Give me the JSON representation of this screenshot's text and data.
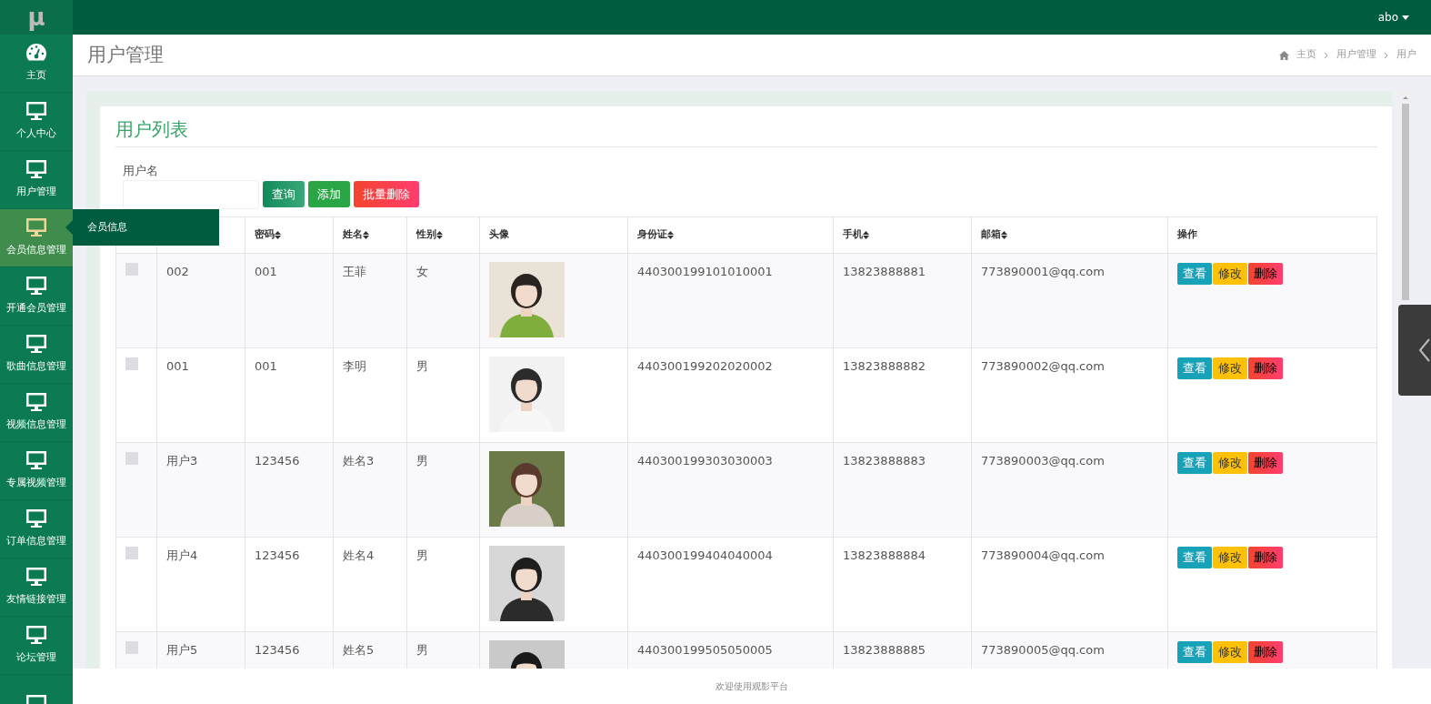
{
  "logo": "μ",
  "topbar": {
    "user": "abo"
  },
  "sidebar": {
    "items": [
      {
        "kind": "dashboard",
        "label": "主页",
        "hovered": false
      },
      {
        "kind": "module",
        "label": "个人中心",
        "hovered": false
      },
      {
        "kind": "module",
        "label": "用户管理",
        "hovered": false
      },
      {
        "kind": "module",
        "label": "会员信息管理",
        "hovered": true,
        "submenu": [
          "会员信息"
        ]
      },
      {
        "kind": "module",
        "label": "开通会员管理",
        "hovered": false
      },
      {
        "kind": "module",
        "label": "歌曲信息管理",
        "hovered": false
      },
      {
        "kind": "module",
        "label": "视频信息管理",
        "hovered": false
      },
      {
        "kind": "module",
        "label": "专属视频管理",
        "hovered": false
      },
      {
        "kind": "module",
        "label": "订单信息管理",
        "hovered": false
      },
      {
        "kind": "module",
        "label": "友情链接管理",
        "hovered": false
      },
      {
        "kind": "module",
        "label": "论坛管理",
        "hovered": false
      },
      {
        "kind": "module",
        "hovered": false
      }
    ]
  },
  "header": {
    "title": "用户管理",
    "breadcrumb": [
      "主页",
      "用户管理",
      "用户"
    ]
  },
  "panel": {
    "title": "用户列表",
    "search": {
      "label": "用户名"
    },
    "buttons": [
      {
        "kind": "search",
        "label": "查询"
      },
      {
        "kind": "add",
        "label": "添加"
      },
      {
        "kind": "delete",
        "label": "批量删除"
      }
    ],
    "table": {
      "columns": [
        {
          "label": "密码",
          "sortable": true
        },
        {
          "label": "姓名",
          "sortable": true
        },
        {
          "label": "性别",
          "sortable": true
        },
        {
          "label": "头像",
          "sortable": false
        },
        {
          "label": "身份证",
          "sortable": true
        },
        {
          "label": "手机",
          "sortable": true
        },
        {
          "label": "邮箱",
          "sortable": true
        },
        {
          "label": "操作",
          "sortable": false
        }
      ],
      "rows": [
        {
          "checked": false,
          "username": "002",
          "password": "001",
          "name": "王菲",
          "gender": "女",
          "id_card": "440300199101010001",
          "phone": "13823888881",
          "email": "773890001@qq.com",
          "actions": [
            {
              "kind": "view",
              "label": "查看"
            },
            {
              "kind": "edit",
              "label": "修改"
            },
            {
              "kind": "delete",
              "label": "删除"
            }
          ]
        },
        {
          "checked": false,
          "username": "001",
          "password": "001",
          "name": "李明",
          "gender": "男",
          "id_card": "440300199202020002",
          "phone": "13823888882",
          "email": "773890002@qq.com",
          "actions": [
            {
              "kind": "view",
              "label": "查看"
            },
            {
              "kind": "edit",
              "label": "修改"
            },
            {
              "kind": "delete",
              "label": "删除"
            }
          ]
        },
        {
          "checked": false,
          "username": "用户3",
          "password": "123456",
          "name": "姓名3",
          "gender": "男",
          "id_card": "440300199303030003",
          "phone": "13823888883",
          "email": "773890003@qq.com",
          "actions": [
            {
              "kind": "view",
              "label": "查看"
            },
            {
              "kind": "edit",
              "label": "修改"
            },
            {
              "kind": "delete",
              "label": "删除"
            }
          ]
        },
        {
          "checked": false,
          "username": "用户4",
          "password": "123456",
          "name": "姓名4",
          "gender": "男",
          "id_card": "440300199404040004",
          "phone": "13823888884",
          "email": "773890004@qq.com",
          "actions": [
            {
              "kind": "view",
              "label": "查看"
            },
            {
              "kind": "edit",
              "label": "修改"
            },
            {
              "kind": "delete",
              "label": "删除"
            }
          ]
        },
        {
          "checked": false,
          "username": "用户5",
          "password": "123456",
          "name": "姓名5",
          "gender": "男",
          "id_card": "440300199505050005",
          "phone": "13823888885",
          "email": "773890005@qq.com",
          "actions": [
            {
              "kind": "view",
              "label": "查看"
            },
            {
              "kind": "edit",
              "label": "修改"
            },
            {
              "kind": "delete",
              "label": "删除"
            }
          ]
        }
      ]
    }
  },
  "footer": "欢迎使用观影平台"
}
